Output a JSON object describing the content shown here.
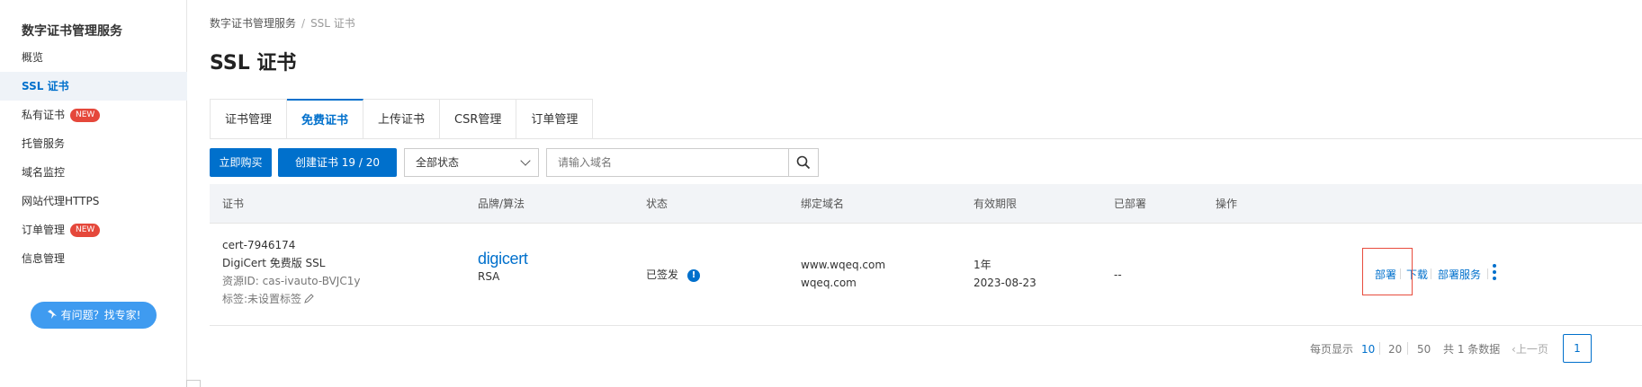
{
  "sidebar": {
    "title": "数字证书管理服务",
    "items": [
      {
        "label": "概览"
      },
      {
        "label": "SSL 证书",
        "active": true
      },
      {
        "label": "私有证书",
        "badge": "NEW"
      },
      {
        "label": "托管服务"
      },
      {
        "label": "域名监控"
      },
      {
        "label": "网站代理HTTPS"
      },
      {
        "label": "订单管理",
        "badge": "NEW"
      },
      {
        "label": "信息管理"
      }
    ],
    "help_button": "有问题？找专家!"
  },
  "breadcrumb": {
    "root": "数字证书管理服务",
    "separator": "/",
    "current": "SSL 证书"
  },
  "page_title": "SSL 证书",
  "tabs": [
    {
      "label": "证书管理"
    },
    {
      "label": "免费证书",
      "active": true
    },
    {
      "label": "上传证书"
    },
    {
      "label": "CSR管理"
    },
    {
      "label": "订单管理"
    }
  ],
  "toolbar": {
    "buy_label": "立即购买",
    "create_label": "创建证书 19 / 20",
    "status_select": "全部状态",
    "search_placeholder": "请输入域名"
  },
  "table": {
    "headers": [
      "证书",
      "品牌/算法",
      "状态",
      "绑定域名",
      "有效期限",
      "已部署",
      "操作"
    ],
    "rows": [
      {
        "cert_id": "cert-7946174",
        "cert_name": "DigiCert 免费版 SSL",
        "resource_id": "资源ID: cas-ivauto-BVJC1y",
        "tags": "标签:未设置标签",
        "brand": "digicert",
        "algorithm": "RSA",
        "status": "已签发",
        "domains": [
          "www.wqeq.com",
          "wqeq.com"
        ],
        "validity": "1年",
        "expiry": "2023-08-23",
        "deployed": "--",
        "actions": {
          "deploy": "部署",
          "download": "下载",
          "deploy_service": "部署服务"
        }
      }
    ]
  },
  "pagination": {
    "per_page_label": "每页显示",
    "sizes": [
      "10",
      "20",
      "50"
    ],
    "selected_size": "10",
    "total": "共 1 条数据",
    "prev": "上一页",
    "current_page": "1"
  },
  "colors": {
    "primary": "#0070cc",
    "accent": "#ff6a00",
    "badge": "#e5483b",
    "highlight_box": "#e84c3d"
  }
}
